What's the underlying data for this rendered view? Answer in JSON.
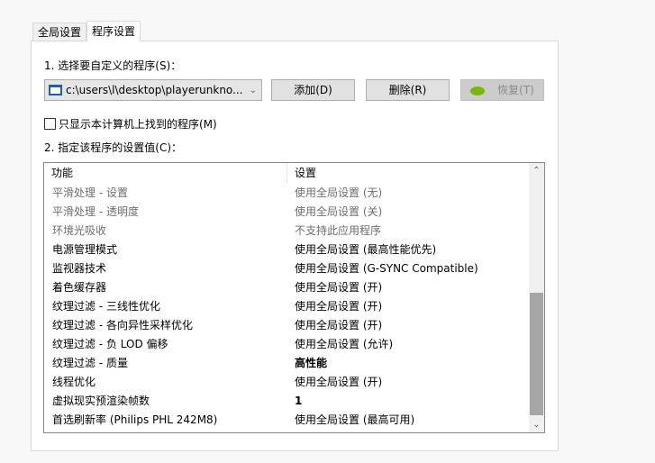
{
  "tabs": [
    {
      "label": "全局设置"
    },
    {
      "label": "程序设置"
    }
  ],
  "step1_label": "1. 选择要自定义的程序(S)：",
  "program_combo": {
    "value": "c:\\users\\l\\desktop\\playerunkno..."
  },
  "buttons": {
    "add": "添加(D)",
    "remove": "删除(R)",
    "restore": "恢复(T)"
  },
  "checkbox": {
    "label": "只显示本计算机上找到的程序(M)",
    "checked": false
  },
  "step2_label": "2. 指定该程序的设置值(C)：",
  "table": {
    "headers": [
      "功能",
      "设置"
    ],
    "rows": [
      {
        "feature": "平滑处理 - 设置",
        "setting": "使用全局设置 (无)",
        "style": "gray"
      },
      {
        "feature": "平滑处理 - 透明度",
        "setting": "使用全局设置 (关)",
        "style": "gray"
      },
      {
        "feature": "环境光吸收",
        "setting": "不支持此应用程序",
        "style": "gray"
      },
      {
        "feature": "电源管理模式",
        "setting": "使用全局设置 (最高性能优先)",
        "style": ""
      },
      {
        "feature": "监视器技术",
        "setting": "使用全局设置 (G-SYNC Compatible)",
        "style": ""
      },
      {
        "feature": "着色缓存器",
        "setting": "使用全局设置 (开)",
        "style": ""
      },
      {
        "feature": "纹理过滤 - 三线性优化",
        "setting": "使用全局设置 (开)",
        "style": ""
      },
      {
        "feature": "纹理过滤 - 各向异性采样优化",
        "setting": "使用全局设置 (开)",
        "style": ""
      },
      {
        "feature": "纹理过滤 - 负 LOD 偏移",
        "setting": "使用全局设置 (允许)",
        "style": ""
      },
      {
        "feature": "纹理过滤 - 质量",
        "setting": "高性能",
        "style": "bold"
      },
      {
        "feature": "线程优化",
        "setting": "使用全局设置 (开)",
        "style": ""
      },
      {
        "feature": "虚拟现实预渲染帧数",
        "setting": "1",
        "style": "bold"
      },
      {
        "feature": "首选刷新率 (Philips PHL 242M8)",
        "setting": "使用全局设置 (最高可用)",
        "style": ""
      }
    ]
  }
}
